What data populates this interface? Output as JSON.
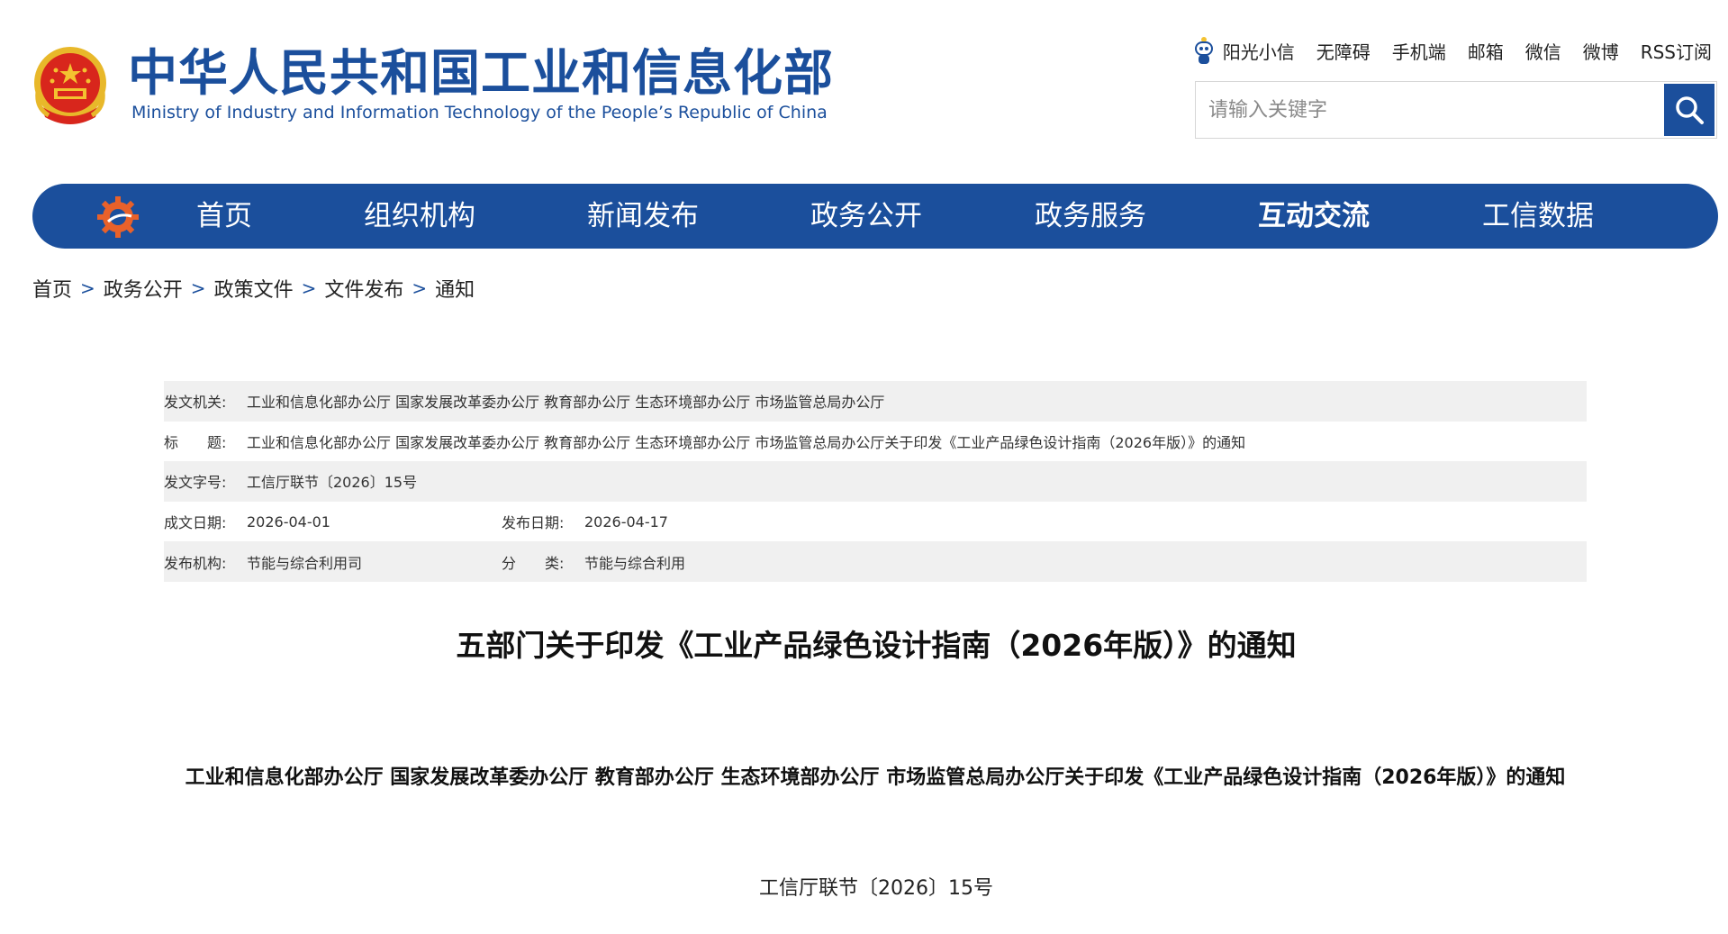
{
  "header": {
    "logo_cn": "中华人民共和国工业和信息化部",
    "logo_en": "Ministry of Industry and Information Technology of the People’s Republic of China",
    "top_links": [
      "阳光小信",
      "无障碍",
      "手机端",
      "邮箱",
      "微信",
      "微博",
      "RSS订阅"
    ],
    "search": {
      "placeholder": "请输入关键字"
    }
  },
  "nav": {
    "items": [
      "首页",
      "组织机构",
      "新闻发布",
      "政务公开",
      "政务服务",
      "互动交流",
      "工信数据"
    ],
    "active": "互动交流"
  },
  "breadcrumb": {
    "items": [
      "首页",
      "政务公开",
      "政策文件",
      "文件发布",
      "通知"
    ],
    "separator": ">"
  },
  "info": {
    "issuer_label": "发文机关:",
    "issuer": "工业和信息化部办公厅 国家发展改革委办公厅 教育部办公厅 生态环境部办公厅 市场监管总局办公厅",
    "title_label": "标　　题:",
    "title": "工业和信息化部办公厅 国家发展改革委办公厅 教育部办公厅 生态环境部办公厅 市场监管总局办公厅关于印发《工业产品绿色设计指南（2026年版）》的通知",
    "doc_no_label": "发文字号:",
    "doc_no": "工信厅联节〔2026〕15号",
    "written_label": "成文日期:",
    "written_date": "2026-04-01",
    "published_label": "发布日期:",
    "published_date": "2026-04-17",
    "agency_label": "发布机构:",
    "agency": "节能与综合利用司",
    "category_label": "分　　类:",
    "category": "节能与综合利用"
  },
  "article": {
    "title": "五部门关于印发《工业产品绿色设计指南（2026年版）》的通知",
    "subtitle": "工业和信息化部办公厅 国家发展改革委办公厅 教育部办公厅 生态环境部办公厅 市场监管总局办公厅关于印发《工业产品绿色设计指南（2026年版）》的通知",
    "doc_number": "工信厅联节〔2026〕15号"
  },
  "colors": {
    "brand_blue": "#1b4f9c",
    "emblem_red": "#d8261c",
    "emblem_gold": "#f4c230",
    "row_shade": "#f0f0f0"
  },
  "icons": [
    "national-emblem-icon",
    "robot-assistant-icon",
    "search-icon",
    "miit-gear-logo-icon"
  ]
}
